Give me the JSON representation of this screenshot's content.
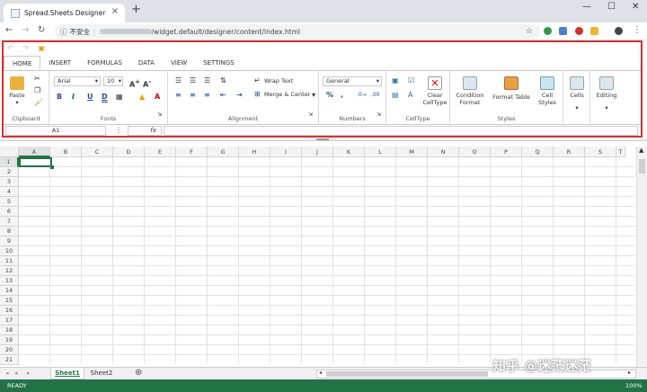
{
  "browser": {
    "tab_title": "Spread.Sheets Designer",
    "security_label": "不安全",
    "url_blurred": "...",
    "url_path": "/widget.default/designer/content/index.html"
  },
  "ribbon": {
    "tabs": [
      "HOME",
      "INSERT",
      "FORMULAS",
      "DATA",
      "VIEW",
      "SETTINGS"
    ],
    "clipboard": {
      "paste": "Paste",
      "label": "Clipboard"
    },
    "fonts": {
      "font": "Arial",
      "size": "10",
      "label": "Fonts",
      "bold": "B",
      "italic": "I",
      "underline": "U"
    },
    "alignment": {
      "wrap": "Wrap Text",
      "merge": "Merge & Center",
      "label": "Alignment"
    },
    "numbers": {
      "format": "General",
      "label": "Numbers",
      "percent": "%",
      "comma": ","
    },
    "celltype": {
      "clear1": "Clear",
      "clear2": "CellType",
      "label": "CellType"
    },
    "styles": {
      "cond1": "Condition",
      "cond2": "Format",
      "fmt": "Format Table",
      "cs1": "Cell",
      "cs2": "Styles",
      "label": "Styles"
    },
    "cells": {
      "label": "Cells"
    },
    "editing": {
      "label": "Editing"
    },
    "namebox": "A1",
    "fx": "fx"
  },
  "sheet": {
    "columns": [
      "A",
      "B",
      "C",
      "D",
      "E",
      "F",
      "G",
      "H",
      "I",
      "J",
      "K",
      "L",
      "M",
      "N",
      "O",
      "P",
      "Q",
      "R",
      "S",
      "T"
    ],
    "rows": [
      "1",
      "2",
      "3",
      "4",
      "5",
      "6",
      "7",
      "8",
      "9",
      "10",
      "11",
      "12",
      "13",
      "14",
      "15",
      "16",
      "17",
      "18",
      "19",
      "20",
      "21"
    ],
    "tabs": [
      "Sheet1",
      "Sheet2"
    ]
  },
  "status": {
    "left": "READY",
    "zoom": "100%"
  },
  "watermark": "知乎 @迷茫迷茫"
}
